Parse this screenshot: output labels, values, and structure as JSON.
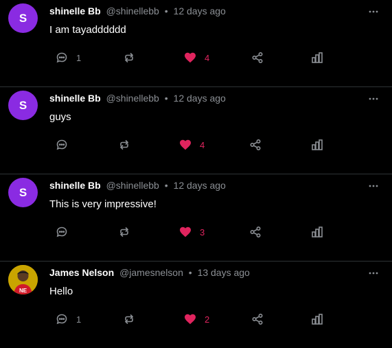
{
  "colors": {
    "background": "#000000",
    "text": "#e7e9ea",
    "muted": "#8b8f94",
    "like": "#e0245e",
    "avatar_purple": "#8a2be2",
    "divider": "#2f3336"
  },
  "posts": [
    {
      "avatar_letter": "S",
      "avatar_type": "letter",
      "display_name": "shinelle Bb",
      "handle": "@shinellebb",
      "separator": "•",
      "time": "12 days ago",
      "text": "I am tayadddddd",
      "replies": "1",
      "reposts": "",
      "likes": "4",
      "liked": true
    },
    {
      "avatar_letter": "S",
      "avatar_type": "letter",
      "display_name": "shinelle Bb",
      "handle": "@shinellebb",
      "separator": "•",
      "time": "12 days ago",
      "text": "guys",
      "replies": "",
      "reposts": "",
      "likes": "4",
      "liked": true
    },
    {
      "avatar_letter": "S",
      "avatar_type": "letter",
      "display_name": "shinelle Bb",
      "handle": "@shinellebb",
      "separator": "•",
      "time": "12 days ago",
      "text": "This is very impressive!",
      "replies": "",
      "reposts": "",
      "likes": "3",
      "liked": true
    },
    {
      "avatar_letter": "",
      "avatar_type": "photo",
      "display_name": "James Nelson",
      "handle": "@jamesnelson",
      "separator": "•",
      "time": "13 days ago",
      "text": "Hello",
      "replies": "1",
      "reposts": "",
      "likes": "2",
      "liked": true
    }
  ],
  "icons": {
    "reply": "chat-bubble-icon",
    "repost": "repost-arrows-icon",
    "like": "heart-icon",
    "share": "share-icon",
    "stats": "bar-chart-icon",
    "more": "more-horizontal-icon"
  }
}
